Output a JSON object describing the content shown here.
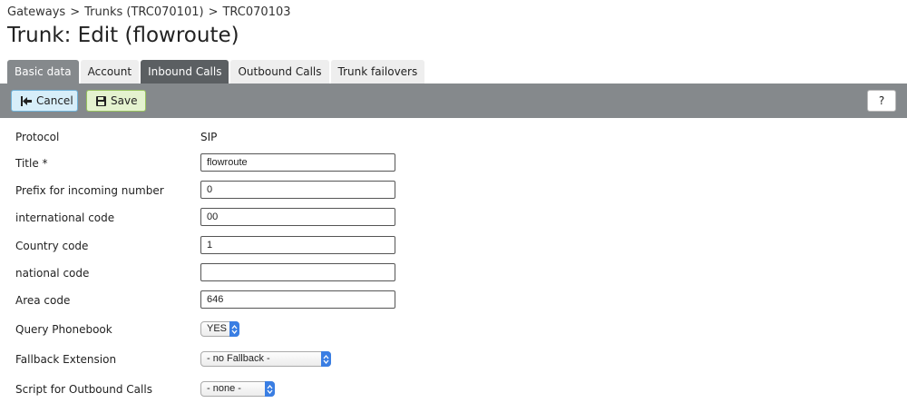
{
  "breadcrumb": {
    "items": [
      "Gateways",
      "Trunks (TRC070101)",
      "TRC070103"
    ],
    "separator": ">"
  },
  "page_title": "Trunk: Edit (flowroute)",
  "tabs": [
    {
      "label": "Basic data"
    },
    {
      "label": "Account"
    },
    {
      "label": "Inbound Calls",
      "active": true
    },
    {
      "label": "Outbound Calls"
    },
    {
      "label": "Trunk failovers"
    }
  ],
  "toolbar": {
    "cancel_label": "Cancel",
    "save_label": "Save",
    "help_label": "?"
  },
  "form": {
    "protocol": {
      "label": "Protocol",
      "value": "SIP"
    },
    "title": {
      "label": "Title *",
      "value": "flowroute"
    },
    "prefix": {
      "label": "Prefix for incoming number",
      "value": "0"
    },
    "international_code": {
      "label": "international code",
      "value": "00"
    },
    "country_code": {
      "label": "Country code",
      "value": "1"
    },
    "national_code": {
      "label": "national code",
      "value": ""
    },
    "area_code": {
      "label": "Area code",
      "value": "646"
    },
    "query_phonebook": {
      "label": "Query Phonebook",
      "value": "YES"
    },
    "fallback_extension": {
      "label": "Fallback Extension",
      "value": "- no Fallback -"
    },
    "outbound_script": {
      "label": "Script for Outbound Calls",
      "value": "- none -"
    }
  },
  "colors": {
    "toolbar": "#85898c",
    "active_tab": "#5b5f62",
    "cancel_bg": "#d7eef9",
    "save_bg": "#e4f2cf",
    "select_stepper": "#3a7ee3"
  },
  "icons": {
    "cancel": "skip-back-icon",
    "save": "floppy-disk-icon",
    "select": "up-down-chevron-icon"
  }
}
